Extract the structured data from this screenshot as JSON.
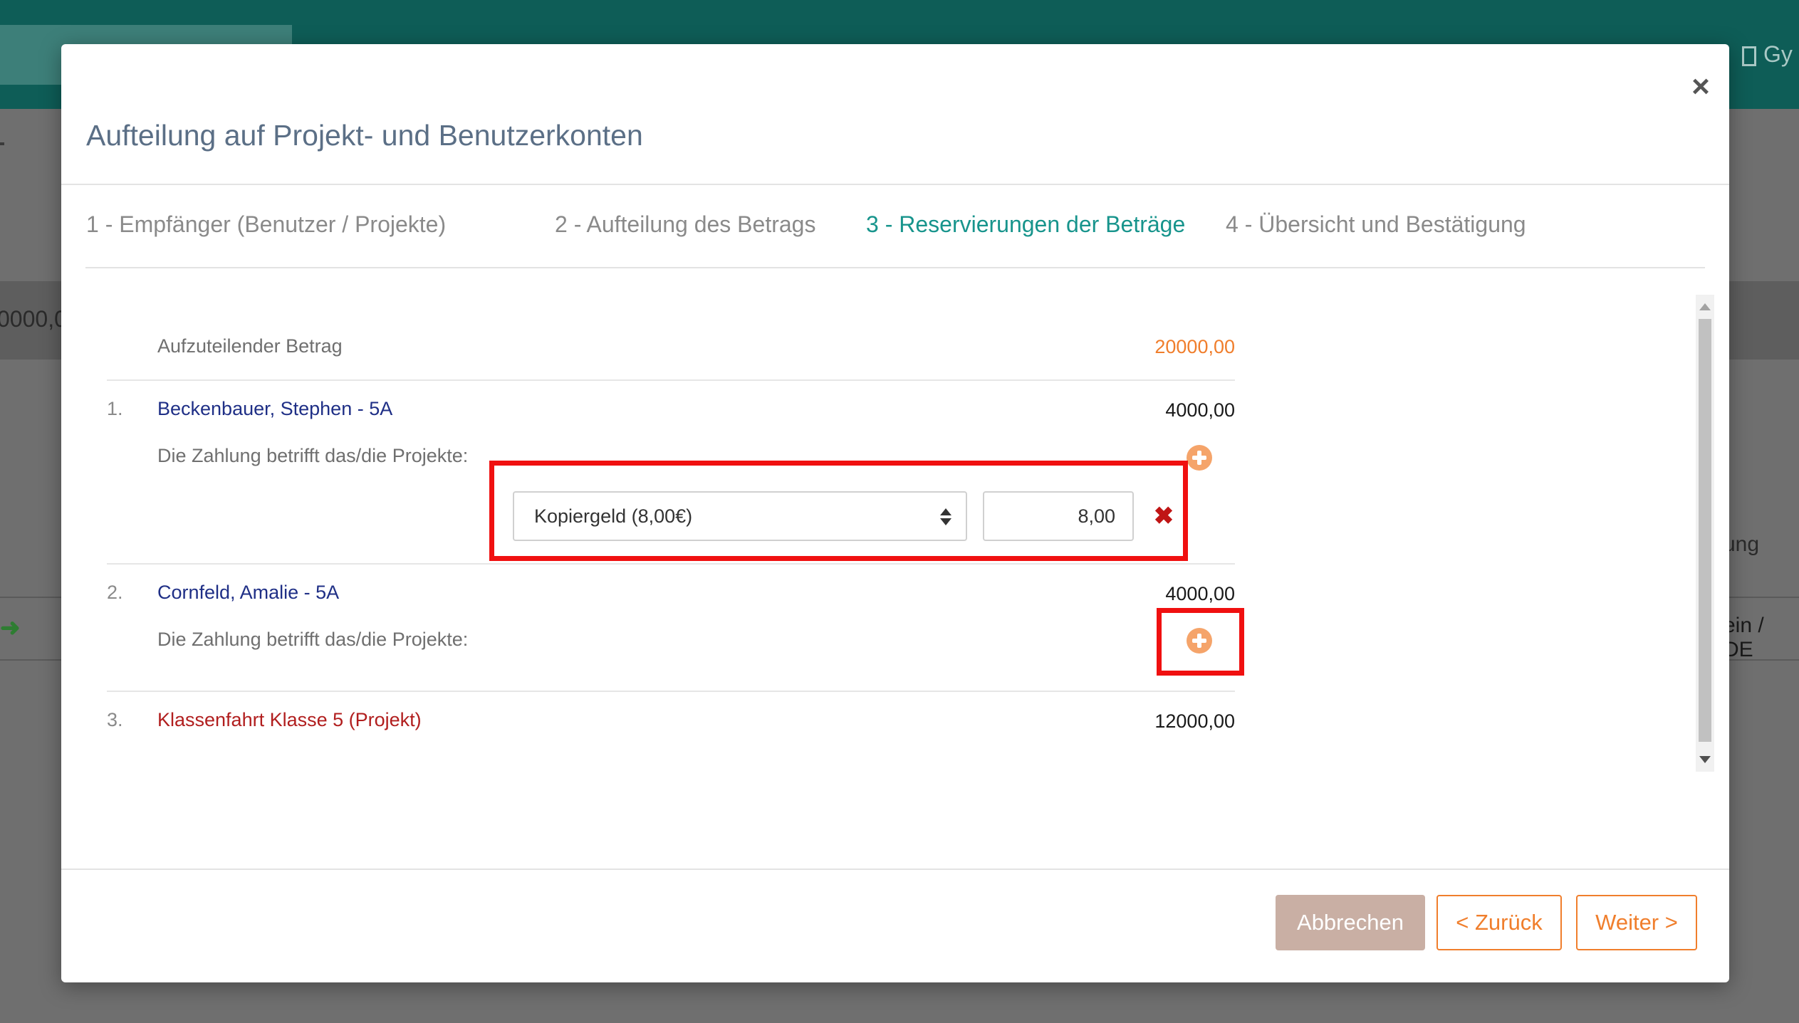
{
  "background": {
    "header_right_text": "Gy",
    "amount_fragment": "0000,0",
    "right_text_1": "ung",
    "right_text_2": "ein / DE"
  },
  "modal": {
    "title": "Aufteilung auf Projekt- und Benutzerkonten",
    "close_glyph": "×",
    "tabs": [
      {
        "label": "1 - Empfänger (Benutzer / Projekte)",
        "active": false
      },
      {
        "label": "2 - Aufteilung des Betrags",
        "active": false
      },
      {
        "label": "3 - Reservierungen der Beträge",
        "active": true
      },
      {
        "label": "4 - Übersicht und Bestätigung",
        "active": false
      }
    ],
    "summary": {
      "label": "Aufzuteilender Betrag",
      "value": "20000,00"
    },
    "entries": [
      {
        "number": "1.",
        "name": "Beckenbauer, Stephen - 5A",
        "amount": "4000,00",
        "projects_label": "Die Zahlung betrifft das/die Projekte:",
        "reservation": {
          "selected_project": "Kopiergeld (8,00€)",
          "amount": "8,00"
        }
      },
      {
        "number": "2.",
        "name": "Cornfeld, Amalie - 5A",
        "amount": "4000,00",
        "projects_label": "Die Zahlung betrifft das/die Projekte:"
      },
      {
        "number": "3.",
        "name": "Klassenfahrt Klasse 5 (Projekt)",
        "amount": "12000,00"
      }
    ],
    "footer": {
      "cancel_label": "Abbrechen",
      "back_label": "< Zurück",
      "next_label": "Weiter >"
    }
  },
  "colors": {
    "accent_teal": "#17948c",
    "accent_orange": "#f07e2c",
    "user_name": "#1f2f86",
    "project_name": "#b11e1e",
    "highlight_red": "#f01010"
  },
  "icons": {
    "close": "close-icon",
    "add": "plus-circle-icon",
    "remove": "remove-x-icon",
    "select": "select-arrows-icon"
  }
}
